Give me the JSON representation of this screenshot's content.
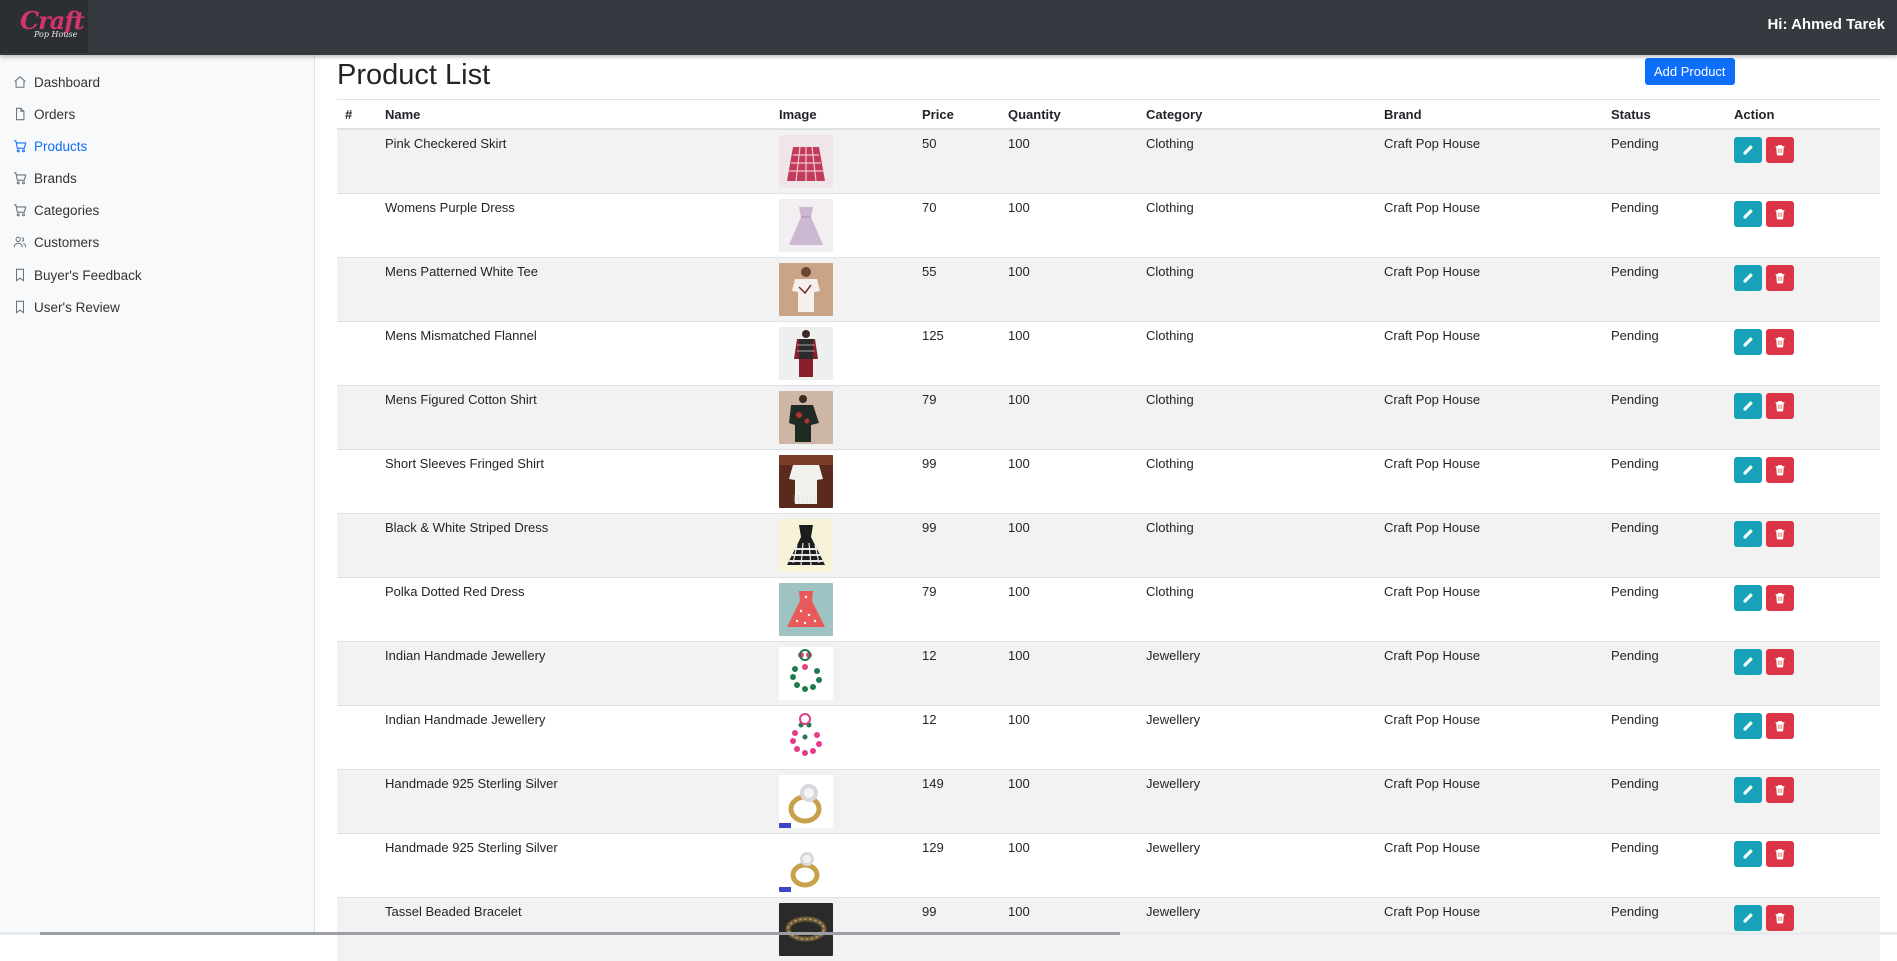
{
  "header": {
    "logo_text": "Craft",
    "logo_subtext": "Pop House",
    "greeting": "Hi: Ahmed Tarek"
  },
  "sidebar": {
    "items": [
      {
        "label": "Dashboard",
        "icon": "house-icon",
        "active": false
      },
      {
        "label": "Orders",
        "icon": "file-icon",
        "active": false
      },
      {
        "label": "Products",
        "icon": "cart-icon",
        "active": true
      },
      {
        "label": "Brands",
        "icon": "cart-icon",
        "active": false
      },
      {
        "label": "Categories",
        "icon": "cart-icon",
        "active": false
      },
      {
        "label": "Customers",
        "icon": "users-icon",
        "active": false
      },
      {
        "label": "Buyer's Feedback",
        "icon": "bookmark-icon",
        "active": false
      },
      {
        "label": "User's Review",
        "icon": "bookmark-icon",
        "active": false
      }
    ]
  },
  "main": {
    "title": "Product List",
    "add_button": "Add Product",
    "columns": [
      "#",
      "Name",
      "Image",
      "Price",
      "Quantity",
      "Category",
      "Brand",
      "Status",
      "Action"
    ],
    "rows": [
      {
        "num": "",
        "name": "Pink Checkered Skirt",
        "image": "pink-checkered-skirt-thumbnail",
        "price": "50",
        "quantity": "100",
        "category": "Clothing",
        "brand": "Craft Pop House",
        "status": "Pending"
      },
      {
        "num": "",
        "name": "Womens Purple Dress",
        "image": "purple-dress-thumbnail",
        "price": "70",
        "quantity": "100",
        "category": "Clothing",
        "brand": "Craft Pop House",
        "status": "Pending"
      },
      {
        "num": "",
        "name": "Mens Patterned White Tee",
        "image": "white-tee-thumbnail",
        "price": "55",
        "quantity": "100",
        "category": "Clothing",
        "brand": "Craft Pop House",
        "status": "Pending"
      },
      {
        "num": "",
        "name": "Mens Mismatched Flannel",
        "image": "flannel-thumbnail",
        "price": "125",
        "quantity": "100",
        "category": "Clothing",
        "brand": "Craft Pop House",
        "status": "Pending"
      },
      {
        "num": "",
        "name": "Mens Figured Cotton Shirt",
        "image": "cotton-shirt-thumbnail",
        "price": "79",
        "quantity": "100",
        "category": "Clothing",
        "brand": "Craft Pop House",
        "status": "Pending"
      },
      {
        "num": "",
        "name": "Short Sleeves Fringed Shirt",
        "image": "fringed-shirt-thumbnail",
        "price": "99",
        "quantity": "100",
        "category": "Clothing",
        "brand": "Craft Pop House",
        "status": "Pending"
      },
      {
        "num": "",
        "name": "Black & White Striped Dress",
        "image": "striped-dress-thumbnail",
        "price": "99",
        "quantity": "100",
        "category": "Clothing",
        "brand": "Craft Pop House",
        "status": "Pending"
      },
      {
        "num": "",
        "name": "Polka Dotted Red Dress",
        "image": "polka-dress-thumbnail",
        "price": "79",
        "quantity": "100",
        "category": "Clothing",
        "brand": "Craft Pop House",
        "status": "Pending"
      },
      {
        "num": "",
        "name": "Indian Handmade Jewellery",
        "image": "green-jewellery-thumbnail",
        "price": "12",
        "quantity": "100",
        "category": "Jewellery",
        "brand": "Craft Pop House",
        "status": "Pending"
      },
      {
        "num": "",
        "name": "Indian Handmade Jewellery",
        "image": "pink-jewellery-thumbnail",
        "price": "12",
        "quantity": "100",
        "category": "Jewellery",
        "brand": "Craft Pop House",
        "status": "Pending"
      },
      {
        "num": "",
        "name": "Handmade 925 Sterling Silver",
        "image": "silver-ring-thumbnail",
        "price": "149",
        "quantity": "100",
        "category": "Jewellery",
        "brand": "Craft Pop House",
        "status": "Pending"
      },
      {
        "num": "",
        "name": "Handmade 925 Sterling Silver",
        "image": "silver-ring-2-thumbnail",
        "price": "129",
        "quantity": "100",
        "category": "Jewellery",
        "brand": "Craft Pop House",
        "status": "Pending"
      },
      {
        "num": "",
        "name": "Tassel Beaded Bracelet",
        "image": "bracelet-thumbnail",
        "price": "99",
        "quantity": "100",
        "category": "Jewellery",
        "brand": "Craft Pop House",
        "status": "Pending"
      }
    ]
  },
  "colors": {
    "topbar": "#343a40",
    "primary": "#0d6efd",
    "edit": "#17a2b8",
    "delete": "#dc3545"
  }
}
